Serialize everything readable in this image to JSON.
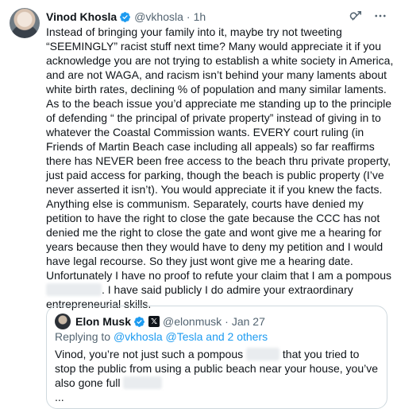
{
  "tweet": {
    "author_name": "Vinod Khosla",
    "author_handle": "@vkhosla",
    "separator": "·",
    "time": "1h",
    "paragraphs": [
      "Instead of bringing your family into it, maybe try not tweeting “SEEMINGLY” racist stuff next time? Many would appreciate it if you acknowledge you are not trying to establish a white society in America, and are not WAGA, and racism isn’t behind your many laments about white birth rates, declining % of population and many similar laments.",
      "As to the beach issue you’d appreciate me standing up to the principle of defending “ the principal of private property” instead of giving in to whatever the Coastal Commission wants. EVERY court ruling (in Friends of Martin Beach case including all appeals) so far reaffirms there has NEVER been free access to the beach thru private property, just paid access for parking, though the beach is public property (I’ve never asserted it isn’t). You would appreciate it if you knew the facts. Anything else is communism. Separately, courts have denied my petition to have the right to close the gate because the CCC has not denied me the right to close the gate and wont give me a hearing for years because then they would have to deny my petition and I would have legal recourse. So they just wont give me a hearing date.",
      "Unfortunately I have no proof to refute your claim that I am a pompous"
    ],
    "last_para_tail": ". I have said publicly I do admire your extraordinary entrepreneurial skills."
  },
  "quote": {
    "author_name": "Elon Musk",
    "author_handle": "@elonmusk",
    "separator": "·",
    "time": "Jan 27",
    "replying_prefix": "Replying to",
    "replying_handles": "@vkhosla @Tesla",
    "replying_suffix": "and 2 others",
    "text_start": "Vinod, you’re not just such a pompous",
    "text_end": "that you tried to stop the public from using a public beach near your house, you’ve also gone full",
    "text_more": "..."
  },
  "colors": {
    "accent": "#1d9bf0",
    "muted": "#536471",
    "text": "#0f1419"
  },
  "icons": [
    "verified-badge-icon",
    "grok-icon",
    "more-icon",
    "x-badge-icon"
  ]
}
